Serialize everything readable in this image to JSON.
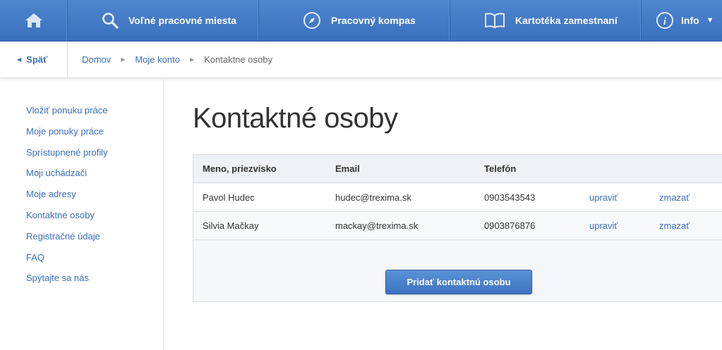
{
  "nav": {
    "home_icon": "home-icon",
    "jobs_label": "Voľné pracovné miesta",
    "compass_label": "Pracovný kompas",
    "cards_label": "Kartotéka zamestnaní",
    "info_label": "Info"
  },
  "breadcrumb": {
    "back_label": "Späť",
    "items": [
      "Domov",
      "Moje konto",
      "Kontaktne osoby"
    ]
  },
  "sidebar": {
    "items": [
      "Vložiť ponuku práce",
      "Moje ponuky práce",
      "Sprístupnené profily",
      "Moji uchádzači",
      "Moje adresy",
      "Kontaktné osoby",
      "Registračné údaje",
      "FAQ",
      "Spýtajte sa nás"
    ]
  },
  "main": {
    "title": "Kontaktné osoby",
    "table": {
      "headers": [
        "Meno, priezvisko",
        "Email",
        "Telefón"
      ],
      "rows": [
        {
          "name": "Pavol Hudec",
          "email": "hudec@trexima.sk",
          "phone": "0903543543",
          "edit": "upraviť",
          "delete": "zmazať"
        },
        {
          "name": "Silvia Mačkay",
          "email": "mackay@trexima.sk",
          "phone": "0903876876",
          "edit": "upraviť",
          "delete": "zmazať"
        }
      ]
    },
    "add_button": "Pridať kontaktnú osobu"
  },
  "colors": {
    "nav_blue": "#4a80cb",
    "link_blue": "#3a6fb9"
  }
}
